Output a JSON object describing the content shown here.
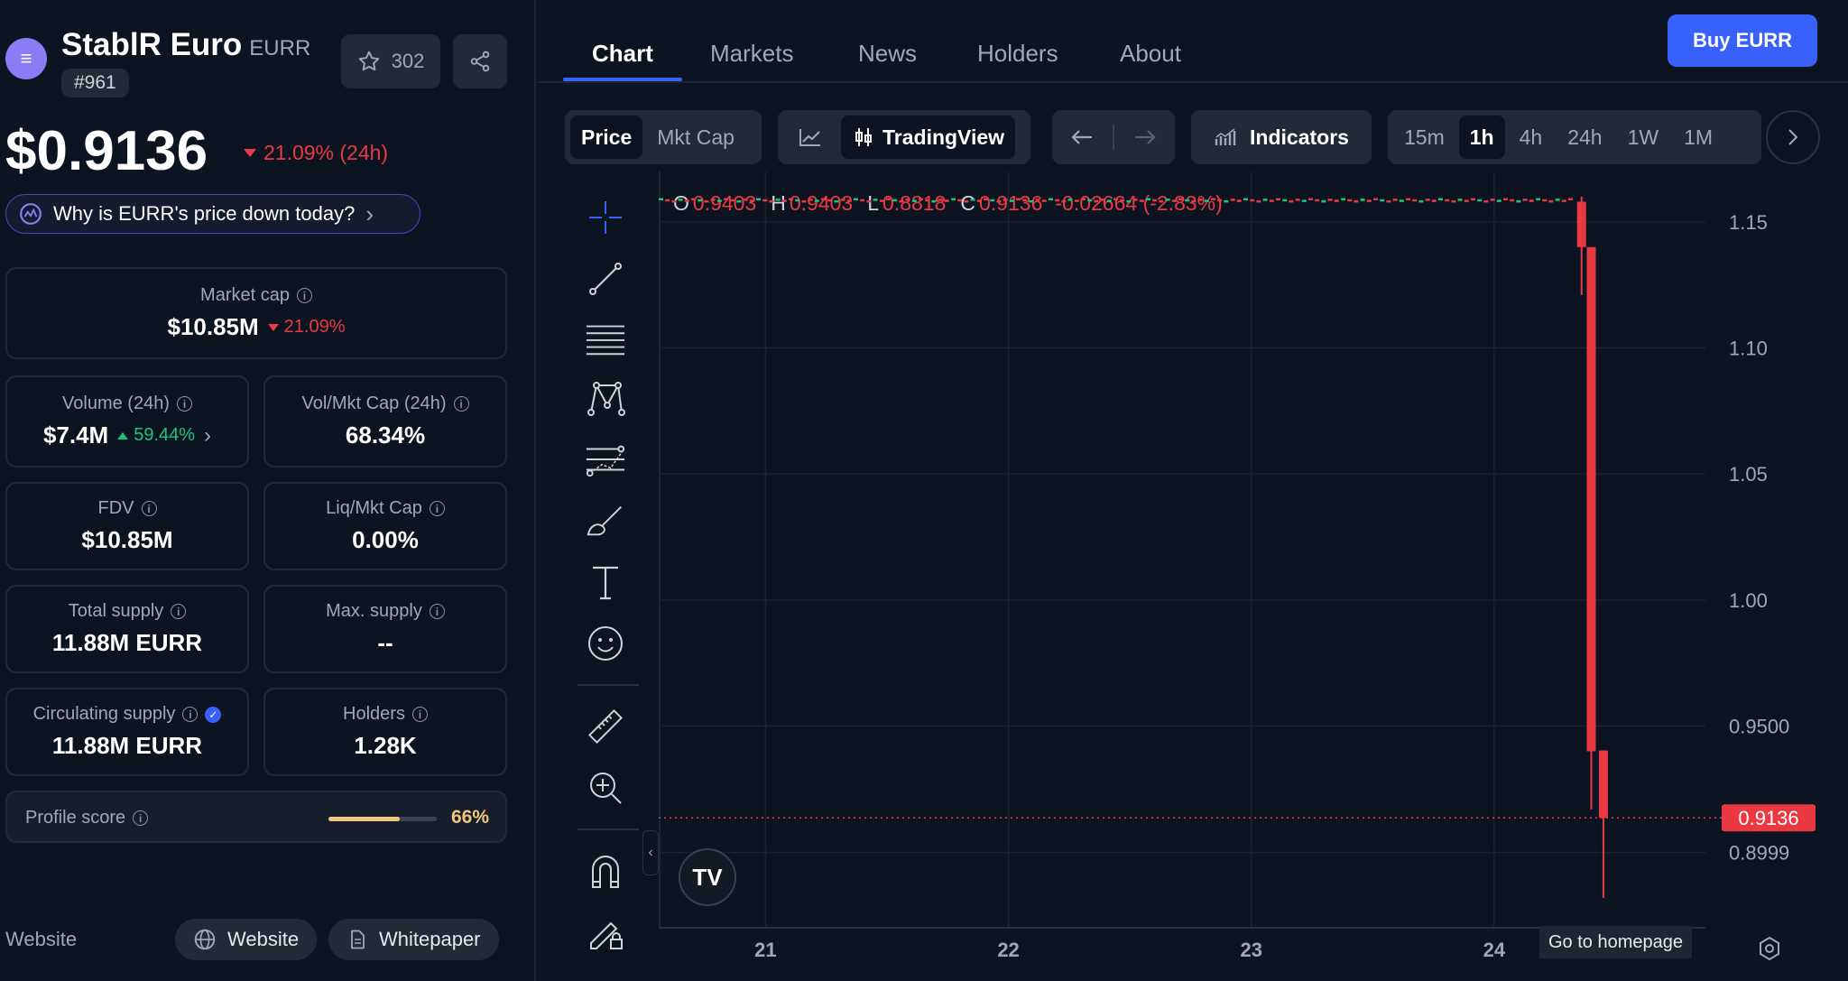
{
  "coin": {
    "name": "StablR Euro",
    "symbol": "EURR",
    "rank": "#961",
    "favorites": "302"
  },
  "price": {
    "value": "$0.9136",
    "change": "21.09% (24h)",
    "why_label": "Why is EURR's price down today?"
  },
  "market_cap": {
    "label": "Market cap",
    "value": "$10.85M",
    "change": "21.09%"
  },
  "volume": {
    "label": "Volume (24h)",
    "value": "$7.4M",
    "change": "59.44%"
  },
  "vol_mkt_cap": {
    "label": "Vol/Mkt Cap (24h)",
    "value": "68.34%"
  },
  "fdv": {
    "label": "FDV",
    "value": "$10.85M"
  },
  "liq_mkt_cap": {
    "label": "Liq/Mkt Cap",
    "value": "0.00%"
  },
  "total_supply": {
    "label": "Total supply",
    "value": "11.88M EURR"
  },
  "max_supply": {
    "label": "Max. supply",
    "value": "--"
  },
  "circulating_supply": {
    "label": "Circulating supply",
    "value": "11.88M EURR"
  },
  "holders": {
    "label": "Holders",
    "value": "1.28K"
  },
  "profile_score": {
    "label": "Profile score",
    "value": "66%",
    "fraction": 0.66
  },
  "links": {
    "section_label": "Website",
    "website": "Website",
    "whitepaper": "Whitepaper"
  },
  "tabs": [
    "Chart",
    "Markets",
    "News",
    "Holders",
    "About"
  ],
  "buy_label": "Buy EURR",
  "chart_toolbar": {
    "price": "Price",
    "mkt_cap": "Mkt Cap",
    "tradingview": "TradingView",
    "indicators": "Indicators",
    "intervals": [
      "15m",
      "1h",
      "4h",
      "24h",
      "1W",
      "1M"
    ],
    "selected_interval": "1h"
  },
  "ohlc": {
    "o_key": "O",
    "o": "0.9403",
    "h_key": "H",
    "h": "0.9403",
    "l_key": "L",
    "l": "0.8818",
    "c_key": "C",
    "c": "0.9136",
    "chg": "-0.02664 (-2.83%)"
  },
  "go_home": "Go to homepage",
  "colors": {
    "up": "#16c784",
    "down": "#ea3943",
    "accent": "#3861fb",
    "background": "#0d1421"
  },
  "chart_data": {
    "type": "candlestick",
    "x_ticks": [
      "21",
      "22",
      "23",
      "24"
    ],
    "y_ticks": [
      "1.15",
      "1.10",
      "1.05",
      "1.00",
      "0.9500",
      "0.8999"
    ],
    "y_tick_values": [
      1.15,
      1.1,
      1.05,
      1.0,
      0.95,
      0.8999
    ],
    "ylim": [
      0.87,
      1.17
    ],
    "xlim": [
      20.56,
      24.87
    ],
    "last_price_label": "0.9136",
    "last_price": 0.9136,
    "flat_level": 1.159,
    "flat_x_range": [
      20.56,
      24.32
    ],
    "candles": [
      {
        "x": 24.36,
        "o": 1.158,
        "h": 1.16,
        "l": 1.121,
        "c": 1.14
      },
      {
        "x": 24.4,
        "o": 1.14,
        "h": 1.14,
        "l": 0.917,
        "c": 0.94
      },
      {
        "x": 24.45,
        "o": 0.9403,
        "h": 0.9403,
        "l": 0.8818,
        "c": 0.9136
      }
    ],
    "grid": true
  }
}
